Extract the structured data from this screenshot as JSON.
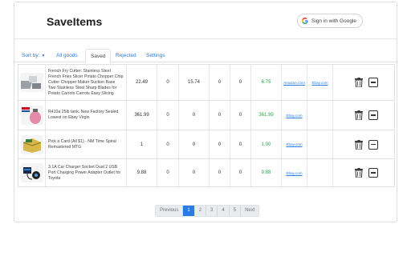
{
  "app": {
    "title": "SaveItems"
  },
  "auth": {
    "google_label": "Sign in with Google"
  },
  "toolbar": {
    "sort_label": "Sort by:",
    "tabs": [
      {
        "label": "All goods"
      },
      {
        "label": "Saved"
      },
      {
        "label": "Rejected"
      },
      {
        "label": "Settings"
      }
    ],
    "active_tab": "Saved"
  },
  "items": [
    {
      "title": "French Fry Cutter: Stainless Steel French Fries Slicer Potato Chopper Chip Cutter Chopper Maker Suction Base Two Stainless Steel Sharp Blades for Potato Carrots Carrots Easy Slicing",
      "price": "22.49",
      "c2": "0",
      "cost": "15.74",
      "c4": "0",
      "c5": "0",
      "profit": "6.75",
      "link1": "Amazon.com",
      "link2": "Ebay.com",
      "thumb_icon": "fry-cutter-image"
    },
    {
      "title": "R410a 25lb tank. New Factory Sealed Lowest on Ebay Virgin",
      "price": "361.99",
      "c2": "0",
      "cost": "0",
      "c4": "0",
      "c5": "0",
      "profit": "361.99",
      "link1": "Ebay.com",
      "link2": "",
      "thumb_icon": "refrigerant-tank-image"
    },
    {
      "title": "Pick a Card (All $1) - NM Time Spiral Remastered MTG",
      "price": "1",
      "c2": "0",
      "cost": "0",
      "c4": "0",
      "c5": "0",
      "profit": "1.00",
      "link1": "Ebay.com",
      "link2": "",
      "thumb_icon": "card-box-image"
    },
    {
      "title": "3.1A Car Charger Socket Dual 2 USB Port Charging Power Adapter Outlet for Toyota",
      "price": "9.88",
      "c2": "0",
      "cost": "0",
      "c4": "0",
      "c5": "0",
      "profit": "9.88",
      "link1": "Ebay.com",
      "link2": "",
      "thumb_icon": "car-charger-image"
    }
  ],
  "pagination": {
    "previous": "Previous",
    "pages": [
      "1",
      "2",
      "3",
      "4",
      "5"
    ],
    "current": "1",
    "next": "Next"
  },
  "colors": {
    "accent": "#2a7be4",
    "profit": "#28a745"
  }
}
